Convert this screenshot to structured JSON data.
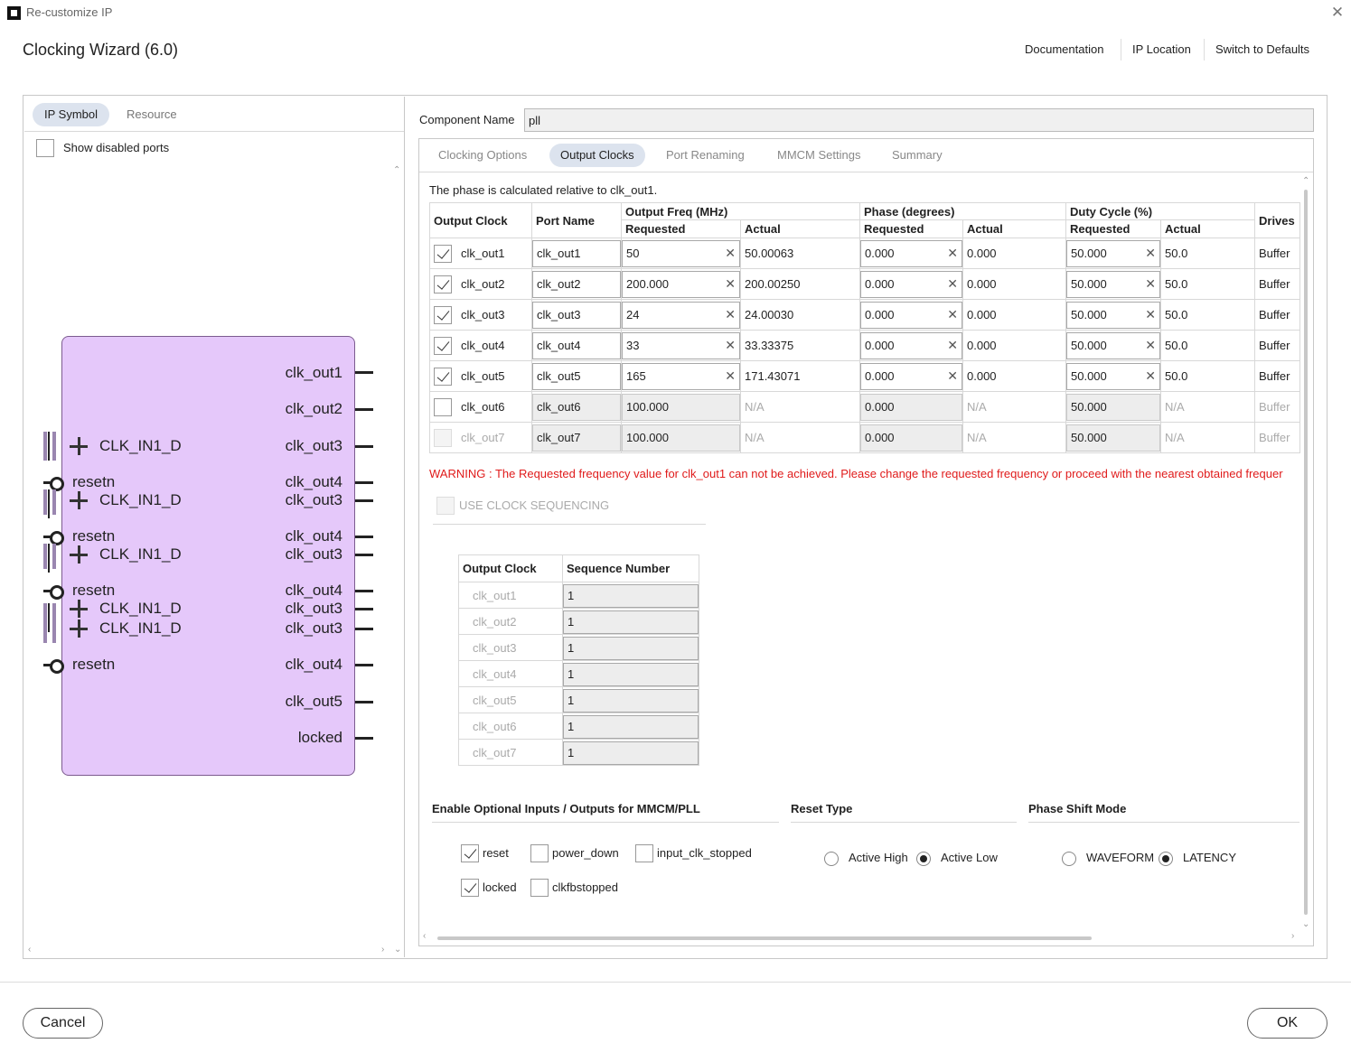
{
  "window": {
    "title": "Re-customize IP",
    "close_icon": "close-icon"
  },
  "header": {
    "title": "Clocking Wizard (6.0)",
    "links": [
      "Documentation",
      "IP Location",
      "Switch to Defaults"
    ]
  },
  "left_panel": {
    "tabs": [
      "IP Symbol",
      "Resource"
    ],
    "active_tab": "IP Symbol",
    "show_disabled_ports": {
      "label": "Show disabled ports",
      "checked": false
    },
    "symbol": {
      "inputs": [
        "CLK_IN1_D",
        "resetn",
        "CLK_IN1_D",
        "resetn",
        "CLK_IN1_D",
        "resetn",
        "CLK_IN1_D",
        "CLK_IN1_D",
        "resetn"
      ],
      "outputs": [
        "clk_out1",
        "clk_out2",
        "clk_out3",
        "clk_out4",
        "clk_out3",
        "clk_out4",
        "clk_out3",
        "clk_out4",
        "clk_out3",
        "clk_out3",
        "clk_out4",
        "clk_out5",
        "locked"
      ],
      "fill_color": "#e5c8fa"
    }
  },
  "component": {
    "label": "Component Name",
    "value": "pll"
  },
  "tabs": [
    "Clocking Options",
    "Output Clocks",
    "Port Renaming",
    "MMCM Settings",
    "Summary"
  ],
  "active_tab": "Output Clocks",
  "phase_note": "The phase is calculated relative to clk_out1.",
  "clock_table": {
    "headers": {
      "output_clock": "Output Clock",
      "port_name": "Port Name",
      "output_freq": "Output Freq (MHz)",
      "phase": "Phase (degrees)",
      "duty_cycle": "Duty Cycle (%)",
      "drives": "Drives",
      "requested": "Requested",
      "actual": "Actual"
    },
    "rows": [
      {
        "clock": "clk_out1",
        "enabled": true,
        "checked": true,
        "port": "clk_out1",
        "freq_req": "50",
        "freq_act": "50.00063",
        "phase_req": "0.000",
        "phase_act": "0.000",
        "duty_req": "50.000",
        "duty_act": "50.0",
        "drives": "Buffer"
      },
      {
        "clock": "clk_out2",
        "enabled": true,
        "checked": true,
        "port": "clk_out2",
        "freq_req": "200.000",
        "freq_act": "200.00250",
        "phase_req": "0.000",
        "phase_act": "0.000",
        "duty_req": "50.000",
        "duty_act": "50.0",
        "drives": "Buffer"
      },
      {
        "clock": "clk_out3",
        "enabled": true,
        "checked": true,
        "port": "clk_out3",
        "freq_req": "24",
        "freq_act": "24.00030",
        "phase_req": "0.000",
        "phase_act": "0.000",
        "duty_req": "50.000",
        "duty_act": "50.0",
        "drives": "Buffer"
      },
      {
        "clock": "clk_out4",
        "enabled": true,
        "checked": true,
        "port": "clk_out4",
        "freq_req": "33",
        "freq_act": "33.33375",
        "phase_req": "0.000",
        "phase_act": "0.000",
        "duty_req": "50.000",
        "duty_act": "50.0",
        "drives": "Buffer"
      },
      {
        "clock": "clk_out5",
        "enabled": true,
        "checked": true,
        "port": "clk_out5",
        "freq_req": "165",
        "freq_act": "171.43071",
        "phase_req": "0.000",
        "phase_act": "0.000",
        "duty_req": "50.000",
        "duty_act": "50.0",
        "drives": "Buffer"
      },
      {
        "clock": "clk_out6",
        "enabled": false,
        "checked": false,
        "port": "clk_out6",
        "freq_req": "100.000",
        "freq_act": "N/A",
        "phase_req": "0.000",
        "phase_act": "N/A",
        "duty_req": "50.000",
        "duty_act": "N/A",
        "drives": "Buffer"
      },
      {
        "clock": "clk_out7",
        "enabled": false,
        "checked": false,
        "disabled_cb": true,
        "port": "clk_out7",
        "freq_req": "100.000",
        "freq_act": "N/A",
        "phase_req": "0.000",
        "phase_act": "N/A",
        "duty_req": "50.000",
        "duty_act": "N/A",
        "drives": "Buffer"
      }
    ]
  },
  "warning": "WARNING : The Requested frequency value for clk_out1 can not be achieved. Please change the requested frequency or proceed with the nearest obtained frequer",
  "clock_sequencing": {
    "label": "USE CLOCK SEQUENCING",
    "checked": false
  },
  "sequence_table": {
    "headers": [
      "Output Clock",
      "Sequence Number"
    ],
    "rows": [
      {
        "clock": "clk_out1",
        "seq": "1"
      },
      {
        "clock": "clk_out2",
        "seq": "1"
      },
      {
        "clock": "clk_out3",
        "seq": "1"
      },
      {
        "clock": "clk_out4",
        "seq": "1"
      },
      {
        "clock": "clk_out5",
        "seq": "1"
      },
      {
        "clock": "clk_out6",
        "seq": "1"
      },
      {
        "clock": "clk_out7",
        "seq": "1"
      }
    ]
  },
  "optional_io": {
    "title": "Enable Optional Inputs / Outputs for MMCM/PLL",
    "options": [
      {
        "label": "reset",
        "checked": true
      },
      {
        "label": "power_down",
        "checked": false
      },
      {
        "label": "input_clk_stopped",
        "checked": false
      },
      {
        "label": "locked",
        "checked": true
      },
      {
        "label": "clkfbstopped",
        "checked": false
      }
    ]
  },
  "reset_type": {
    "title": "Reset Type",
    "options": [
      {
        "label": "Active High",
        "selected": false
      },
      {
        "label": "Active Low",
        "selected": true
      }
    ]
  },
  "phase_shift_mode": {
    "title": "Phase Shift Mode",
    "options": [
      {
        "label": "WAVEFORM",
        "selected": false
      },
      {
        "label": "LATENCY",
        "selected": true
      }
    ]
  },
  "footer": {
    "cancel": "Cancel",
    "ok": "OK"
  }
}
